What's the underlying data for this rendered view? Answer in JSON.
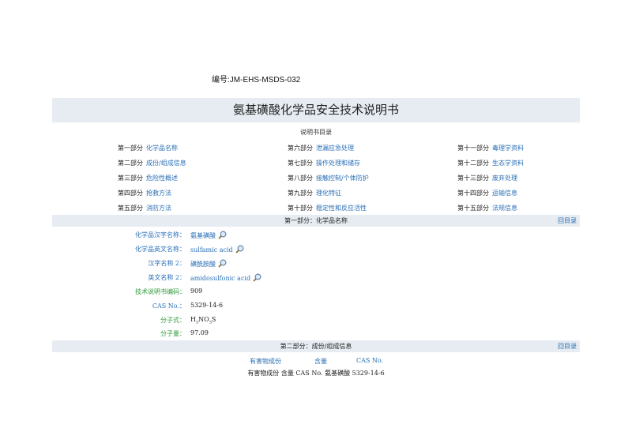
{
  "doc_number": "编号:JM-EHS-MSDS-032",
  "title": "氨基磺酸化学品安全技术说明书",
  "toc": {
    "heading": "说明书目录",
    "items": [
      {
        "part": "第一部分",
        "name": "化学品名称"
      },
      {
        "part": "第二部分",
        "name": "成份/组成信息"
      },
      {
        "part": "第三部分",
        "name": "危险性概述"
      },
      {
        "part": "第四部分",
        "name": "抢救方法"
      },
      {
        "part": "第五部分",
        "name": "消防方法"
      },
      {
        "part": "第六部分",
        "name": "泄漏应急处理"
      },
      {
        "part": "第七部分",
        "name": "操作处理和储存"
      },
      {
        "part": "第八部分",
        "name": "接触控制/个体防护"
      },
      {
        "part": "第九部分",
        "name": "理化特征"
      },
      {
        "part": "第十部分",
        "name": "稳定性和反应活性"
      },
      {
        "part": "第十一部分",
        "name": "毒理学资料"
      },
      {
        "part": "第十二部分",
        "name": "生态学资料"
      },
      {
        "part": "第十三部分",
        "name": "废弃处理"
      },
      {
        "part": "第十四部分",
        "name": "运输信息"
      },
      {
        "part": "第十五部分",
        "name": "法规信息"
      }
    ]
  },
  "section1": {
    "title": "第一部分：化学品名称",
    "back": "回目录",
    "fields": [
      {
        "label": "化学品汉字名称：",
        "value": "氨基磺酸"
      },
      {
        "label": "化学品英文名称：",
        "value": "sulfamic  acid"
      },
      {
        "label": "汉字名称 2：",
        "value": "磺酰胺酸"
      },
      {
        "label": "英文名称 2：",
        "value": "amidosulfonic  acid"
      },
      {
        "label": "技术说明书编码：",
        "value": "909"
      },
      {
        "label": "CAS No.：",
        "value": "5329-14-6"
      },
      {
        "label": "分子式：",
        "value_parts": [
          "H",
          "3",
          "NO",
          "3",
          "S"
        ]
      },
      {
        "label": "分子量：",
        "value": "97.09"
      }
    ]
  },
  "section2": {
    "title": "第二部分：成份/组成信息",
    "back": "回目录",
    "headers": [
      "有害物成份",
      "含量",
      "CAS No."
    ],
    "row": "有害物成份  含量  CAS No.  氨基磺酸  5329-14-6"
  },
  "icons": {
    "search": "magnifier-icon"
  },
  "colors": {
    "link": "#2a6fb6",
    "green_label": "#2f9a3a",
    "bar": "#e6ecf2"
  }
}
